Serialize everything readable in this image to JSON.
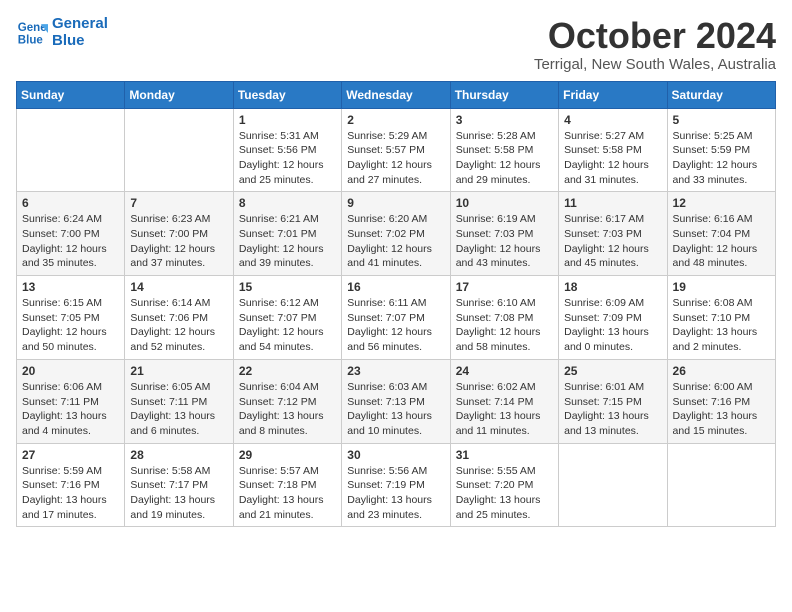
{
  "logo": {
    "line1": "General",
    "line2": "Blue"
  },
  "title": "October 2024",
  "subtitle": "Terrigal, New South Wales, Australia",
  "days_of_week": [
    "Sunday",
    "Monday",
    "Tuesday",
    "Wednesday",
    "Thursday",
    "Friday",
    "Saturday"
  ],
  "weeks": [
    [
      {
        "day": "",
        "info": ""
      },
      {
        "day": "",
        "info": ""
      },
      {
        "day": "1",
        "info": "Sunrise: 5:31 AM\nSunset: 5:56 PM\nDaylight: 12 hours\nand 25 minutes."
      },
      {
        "day": "2",
        "info": "Sunrise: 5:29 AM\nSunset: 5:57 PM\nDaylight: 12 hours\nand 27 minutes."
      },
      {
        "day": "3",
        "info": "Sunrise: 5:28 AM\nSunset: 5:58 PM\nDaylight: 12 hours\nand 29 minutes."
      },
      {
        "day": "4",
        "info": "Sunrise: 5:27 AM\nSunset: 5:58 PM\nDaylight: 12 hours\nand 31 minutes."
      },
      {
        "day": "5",
        "info": "Sunrise: 5:25 AM\nSunset: 5:59 PM\nDaylight: 12 hours\nand 33 minutes."
      }
    ],
    [
      {
        "day": "6",
        "info": "Sunrise: 6:24 AM\nSunset: 7:00 PM\nDaylight: 12 hours\nand 35 minutes."
      },
      {
        "day": "7",
        "info": "Sunrise: 6:23 AM\nSunset: 7:00 PM\nDaylight: 12 hours\nand 37 minutes."
      },
      {
        "day": "8",
        "info": "Sunrise: 6:21 AM\nSunset: 7:01 PM\nDaylight: 12 hours\nand 39 minutes."
      },
      {
        "day": "9",
        "info": "Sunrise: 6:20 AM\nSunset: 7:02 PM\nDaylight: 12 hours\nand 41 minutes."
      },
      {
        "day": "10",
        "info": "Sunrise: 6:19 AM\nSunset: 7:03 PM\nDaylight: 12 hours\nand 43 minutes."
      },
      {
        "day": "11",
        "info": "Sunrise: 6:17 AM\nSunset: 7:03 PM\nDaylight: 12 hours\nand 45 minutes."
      },
      {
        "day": "12",
        "info": "Sunrise: 6:16 AM\nSunset: 7:04 PM\nDaylight: 12 hours\nand 48 minutes."
      }
    ],
    [
      {
        "day": "13",
        "info": "Sunrise: 6:15 AM\nSunset: 7:05 PM\nDaylight: 12 hours\nand 50 minutes."
      },
      {
        "day": "14",
        "info": "Sunrise: 6:14 AM\nSunset: 7:06 PM\nDaylight: 12 hours\nand 52 minutes."
      },
      {
        "day": "15",
        "info": "Sunrise: 6:12 AM\nSunset: 7:07 PM\nDaylight: 12 hours\nand 54 minutes."
      },
      {
        "day": "16",
        "info": "Sunrise: 6:11 AM\nSunset: 7:07 PM\nDaylight: 12 hours\nand 56 minutes."
      },
      {
        "day": "17",
        "info": "Sunrise: 6:10 AM\nSunset: 7:08 PM\nDaylight: 12 hours\nand 58 minutes."
      },
      {
        "day": "18",
        "info": "Sunrise: 6:09 AM\nSunset: 7:09 PM\nDaylight: 13 hours\nand 0 minutes."
      },
      {
        "day": "19",
        "info": "Sunrise: 6:08 AM\nSunset: 7:10 PM\nDaylight: 13 hours\nand 2 minutes."
      }
    ],
    [
      {
        "day": "20",
        "info": "Sunrise: 6:06 AM\nSunset: 7:11 PM\nDaylight: 13 hours\nand 4 minutes."
      },
      {
        "day": "21",
        "info": "Sunrise: 6:05 AM\nSunset: 7:11 PM\nDaylight: 13 hours\nand 6 minutes."
      },
      {
        "day": "22",
        "info": "Sunrise: 6:04 AM\nSunset: 7:12 PM\nDaylight: 13 hours\nand 8 minutes."
      },
      {
        "day": "23",
        "info": "Sunrise: 6:03 AM\nSunset: 7:13 PM\nDaylight: 13 hours\nand 10 minutes."
      },
      {
        "day": "24",
        "info": "Sunrise: 6:02 AM\nSunset: 7:14 PM\nDaylight: 13 hours\nand 11 minutes."
      },
      {
        "day": "25",
        "info": "Sunrise: 6:01 AM\nSunset: 7:15 PM\nDaylight: 13 hours\nand 13 minutes."
      },
      {
        "day": "26",
        "info": "Sunrise: 6:00 AM\nSunset: 7:16 PM\nDaylight: 13 hours\nand 15 minutes."
      }
    ],
    [
      {
        "day": "27",
        "info": "Sunrise: 5:59 AM\nSunset: 7:16 PM\nDaylight: 13 hours\nand 17 minutes."
      },
      {
        "day": "28",
        "info": "Sunrise: 5:58 AM\nSunset: 7:17 PM\nDaylight: 13 hours\nand 19 minutes."
      },
      {
        "day": "29",
        "info": "Sunrise: 5:57 AM\nSunset: 7:18 PM\nDaylight: 13 hours\nand 21 minutes."
      },
      {
        "day": "30",
        "info": "Sunrise: 5:56 AM\nSunset: 7:19 PM\nDaylight: 13 hours\nand 23 minutes."
      },
      {
        "day": "31",
        "info": "Sunrise: 5:55 AM\nSunset: 7:20 PM\nDaylight: 13 hours\nand 25 minutes."
      },
      {
        "day": "",
        "info": ""
      },
      {
        "day": "",
        "info": ""
      }
    ]
  ]
}
